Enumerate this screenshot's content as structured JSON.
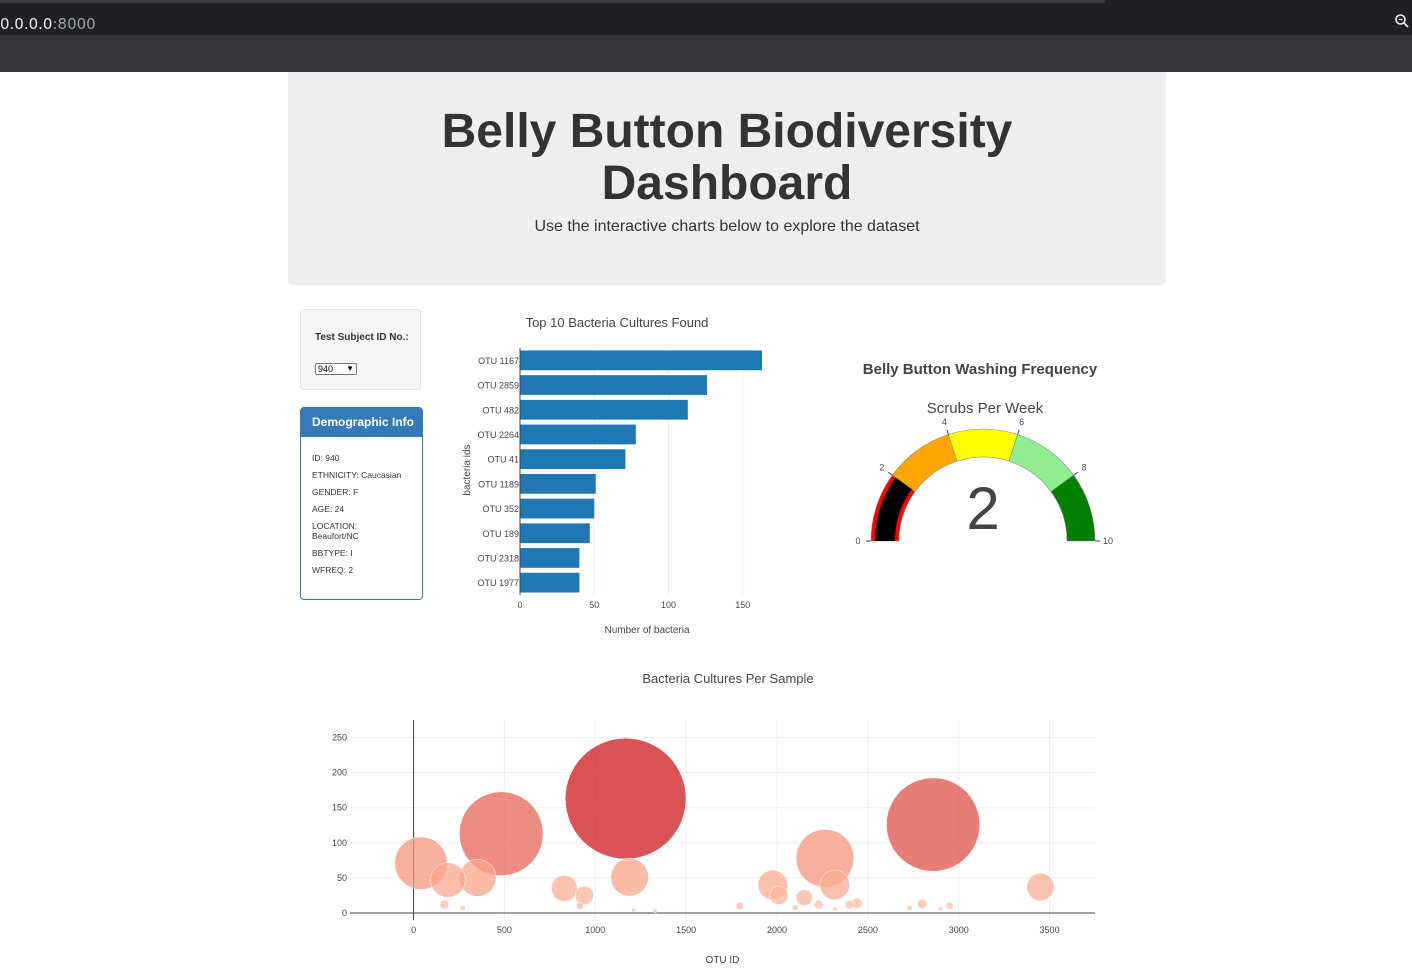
{
  "browser": {
    "url_host": "0.0.0.0",
    "url_port": ":8000",
    "zoom_icon": "magnifier-icon"
  },
  "header": {
    "title_line1": "Belly Button Biodiversity",
    "title_line2": "Dashboard",
    "subtitle": "Use the interactive charts below to explore the dataset"
  },
  "selector": {
    "label": "Test Subject ID No.:",
    "selected": "940"
  },
  "demographics": {
    "heading": "Demographic Info",
    "lines": [
      "ID: 940",
      "ETHNICITY: Caucasian",
      "GENDER: F",
      "AGE: 24",
      "LOCATION: Beaufort/NC",
      "BBTYPE: I",
      "WFREQ: 2"
    ]
  },
  "colors": {
    "bar": "#1f77b4",
    "panel": "#337ab7",
    "jumbotron": "#eeeeee"
  },
  "chart_data": [
    {
      "type": "bar",
      "orientation": "horizontal",
      "title": "Top 10 Bacteria Cultures Found",
      "xlabel": "Number of bacteria",
      "ylabel": "bacteria ids",
      "categories": [
        "OTU 1167",
        "OTU 2859",
        "OTU 482",
        "OTU 2264",
        "OTU 41",
        "OTU 1189",
        "OTU 352",
        "OTU 189",
        "OTU 2318",
        "OTU 1977"
      ],
      "values": [
        163,
        126,
        113,
        78,
        71,
        51,
        50,
        47,
        40,
        40
      ],
      "xlim": [
        0,
        165
      ],
      "xticks": [
        0,
        50,
        100,
        150
      ]
    },
    {
      "type": "gauge",
      "title": "Belly Button Washing Frequency",
      "subtitle": "Scrubs Per Week",
      "value": 2,
      "range": [
        0,
        10
      ],
      "ticks": [
        0,
        2,
        4,
        6,
        8,
        10
      ],
      "steps": [
        {
          "range": [
            0,
            2
          ],
          "color": "#ff0000"
        },
        {
          "range": [
            2,
            4
          ],
          "color": "#ffa500"
        },
        {
          "range": [
            4,
            6
          ],
          "color": "#ffff00"
        },
        {
          "range": [
            6,
            8
          ],
          "color": "#90ee90"
        },
        {
          "range": [
            8,
            10
          ],
          "color": "#008000"
        }
      ],
      "bar_color": "#000000"
    },
    {
      "type": "scatter",
      "title": "Bacteria Cultures Per Sample",
      "xlabel": "OTU ID",
      "ylabel": "",
      "xlim": [
        -350,
        3750
      ],
      "ylim": [
        -10,
        275
      ],
      "xticks": [
        0,
        500,
        1000,
        1500,
        2000,
        2500,
        3000,
        3500
      ],
      "yticks": [
        0,
        50,
        100,
        150,
        200,
        250
      ],
      "colorscale": "Reds",
      "x": [
        1167,
        2859,
        482,
        2264,
        41,
        1189,
        352,
        189,
        2318,
        1977,
        3450,
        940,
        2010,
        2150,
        830,
        2400,
        2950,
        170,
        2800,
        1795,
        2100,
        915,
        2230,
        2320,
        2440,
        2730,
        2900,
        270,
        1210,
        1330
      ],
      "y": [
        163,
        126,
        113,
        78,
        71,
        51,
        50,
        47,
        40,
        40,
        37,
        25,
        25,
        22,
        35,
        12,
        10,
        12,
        13,
        10,
        8,
        10,
        12,
        6,
        14,
        7,
        6,
        7,
        4,
        3
      ]
    }
  ]
}
